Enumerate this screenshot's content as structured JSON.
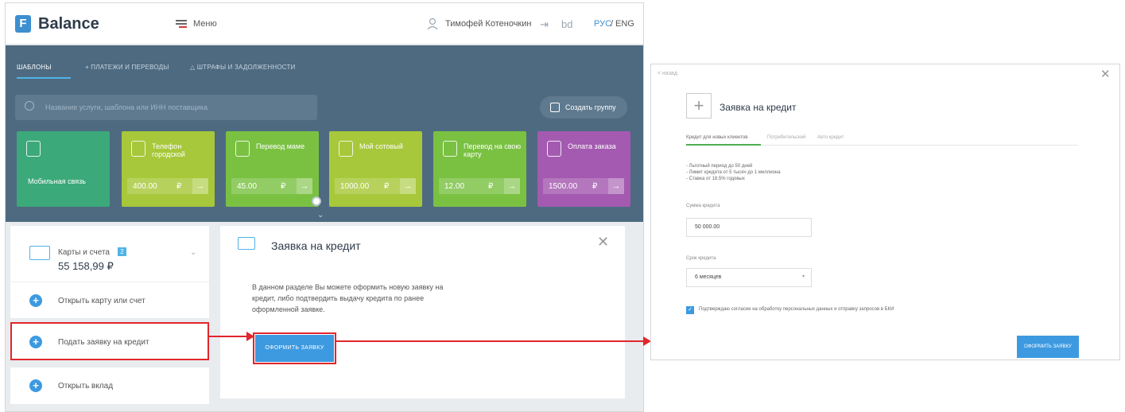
{
  "header": {
    "logo_letter": "F",
    "app_name": "Balance",
    "menu_label": "Меню",
    "user_name": "Тимофей Котеночкин",
    "lang_ru": "РУС",
    "lang_sep": "/",
    "lang_en": "ENG"
  },
  "nav": {
    "tabs": [
      {
        "label": "ШАБЛОНЫ"
      },
      {
        "label": "+ ПЛАТЕЖИ И ПЕРЕВОДЫ"
      },
      {
        "label": "△ ШТРАФЫ И ЗАДОЛЖЕННОСТИ"
      }
    ]
  },
  "search": {
    "placeholder": "Название услуги, шаблона или ИНН поставщика"
  },
  "group_button": "Создать группу",
  "tiles": [
    {
      "title": "Мобильная связь",
      "amount": "",
      "currency": ""
    },
    {
      "title": "Телефон городской",
      "amount": "400.00",
      "currency": "₽"
    },
    {
      "title": "Перевод маме",
      "amount": "45.00",
      "currency": "₽"
    },
    {
      "title": "Мой сотовый",
      "amount": "1000.00",
      "currency": "₽"
    },
    {
      "title": "Перевод на свою карту",
      "amount": "12.00",
      "currency": "₽"
    },
    {
      "title": "Оплата заказа",
      "amount": "1500.00",
      "currency": "₽"
    }
  ],
  "accounts": {
    "label": "Карты и счета",
    "badge": "2",
    "amount": "55 158,99 ₽"
  },
  "side_actions": [
    {
      "label": "Открыть карту или счет"
    },
    {
      "label": "Подать заявку на кредит"
    },
    {
      "label": "Открыть вклад"
    }
  ],
  "credit_panel": {
    "title": "Заявка на кредит",
    "description": "В данном разделе Вы можете оформить новую заявку на кредит, либо подтвердить выдачу кредита по ранее оформленной заявке.",
    "button": "ОФОРМИТЬ ЗАЯВКУ"
  },
  "credit_form": {
    "back": "< назад",
    "title": "Заявка на кредит",
    "tabs": [
      {
        "label": "Кредит для новых клиентов"
      },
      {
        "label": "Потребительский"
      },
      {
        "label": "Авто кредит"
      }
    ],
    "conditions": [
      "- Льготный период до 50 дней",
      "- Лимит кредита от 5 тысяч до 1 миллиона",
      "- Ставка от 18.5% годовых"
    ],
    "amount_label": "Сумма кредита",
    "amount_value": "50 000.00",
    "term_label": "Срок кредита",
    "term_value": "6 месяцев",
    "consent": "Подтверждаю согласие на обработку персональных данных и отправку запросов в БКИ",
    "button": "ОФОРМИТЬ ЗАЯВКУ"
  },
  "colors": {
    "accent": "#3d9ae0",
    "highlight": "#e1262d",
    "header_bg": "#4e6a80"
  }
}
